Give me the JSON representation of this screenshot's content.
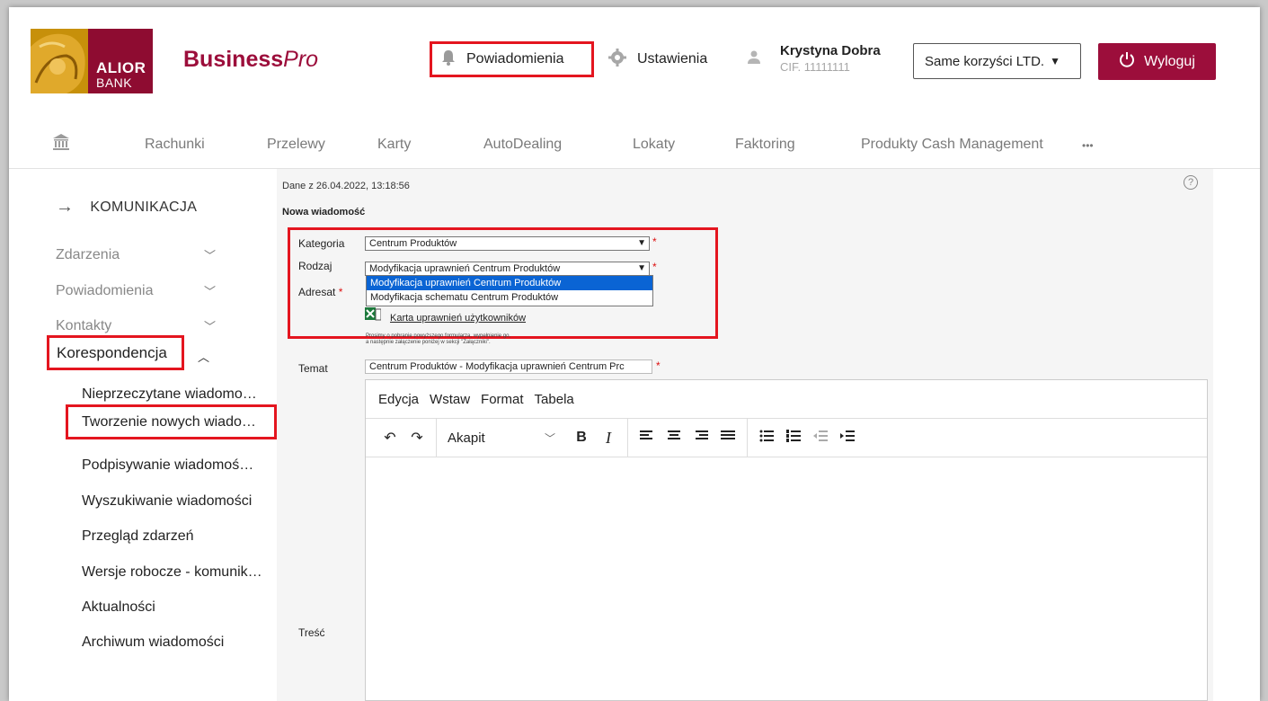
{
  "header": {
    "bank_name_line1": "ALIOR",
    "bank_name_line2": "BANK",
    "brand_bold": "Business",
    "brand_italic": "Pro",
    "notifications_label": "Powiadomienia",
    "settings_label": "Ustawienia",
    "user_name": "Krystyna Dobra",
    "user_cif": "CIF. 11111111",
    "company": "Same korzyści LTD.",
    "logout_label": "Wyloguj"
  },
  "topnav": {
    "items": [
      "Rachunki",
      "Przelewy",
      "Karty",
      "AutoDealing",
      "Lokaty",
      "Faktoring",
      "Produkty Cash Management"
    ],
    "more": "•••"
  },
  "sidebar": {
    "heading": "KOMUNIKACJA",
    "sections": [
      "Zdarzenia",
      "Powiadomienia",
      "Kontakty",
      "Korespondencja"
    ],
    "sub_items": [
      "Nieprzeczytane wiadomo…",
      "Tworzenie nowych wiado…",
      "Podpisywanie wiadomoś…",
      "Wyszukiwanie wiadomości",
      "Przegląd zdarzeń",
      "Wersje robocze - komunik…",
      "Aktualności",
      "Archiwum wiadomości"
    ]
  },
  "form": {
    "date_text": "Dane z 26.04.2022, 13:18:56",
    "title": "Nowa wiadomość",
    "kategoria_label": "Kategoria",
    "kategoria_value": "Centrum Produktów",
    "rodzaj_label": "Rodzaj",
    "rodzaj_value": "Modyfikacja uprawnień Centrum Produktów",
    "rodzaj_options": [
      "Modyfikacja uprawnień Centrum Produktów",
      "Modyfikacja schematu Centrum Produktów"
    ],
    "adresat_label": "Adresat",
    "required_mark": "*",
    "karta_link": "Karta uprawnień użytkowników",
    "hint_line1": "Prosimy o pobranie powyższego formularza, wypełnienie go,",
    "hint_line2": "a następnie załączenie poniżej w sekcji \"Załączniki\".",
    "temat_label": "Temat",
    "temat_value": "Centrum Produktów - Modyfikacja uprawnień Centrum Prc",
    "tresc_label": "Treść"
  },
  "editor": {
    "menu": [
      "Edycja",
      "Wstaw",
      "Format",
      "Tabela"
    ],
    "format_value": "Akapit"
  },
  "colors": {
    "brand": "#9c0e3b",
    "highlight": "#e4151f",
    "selected_option": "#0a64d4"
  }
}
